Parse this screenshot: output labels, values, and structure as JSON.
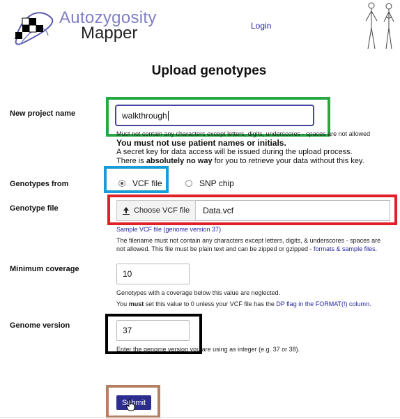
{
  "header": {
    "logo_line1": "Autozygosity",
    "logo_line2": "Mapper",
    "login_label": "Login"
  },
  "page_title": "Upload genotypes",
  "project": {
    "label": "New project name",
    "value": "walkthrough",
    "hint": "Must not contain any characters except letters, digits, underscores - spaces are not allowed",
    "warning_bold": "You must not use patient names or initials.",
    "secret_text_1": "A secret key for data access will be issued during the upload process. There is",
    "secret_text_2_bold": "absolutely no way",
    "secret_text_3": "for you to retrieve your data without this key."
  },
  "genotypes_from": {
    "label": "Genotypes from",
    "options": [
      {
        "label": "VCF file",
        "selected": true
      },
      {
        "label": "SNP chip",
        "selected": false
      }
    ]
  },
  "genotype_file": {
    "label": "Genotype file",
    "button_label": "Choose VCF file",
    "filename": "Data.vcf",
    "sample_link": "Sample VCF file (genome version 37)",
    "note_1": "The filename must not contain any characters except letters, digits, & underscores - spaces are not",
    "note_2": "allowed. This file must be plain text and can be zipped or gzipped -",
    "note_link": "formats & sample files."
  },
  "min_coverage": {
    "label": "Minimum coverage",
    "value": "10",
    "note_1": "Genotypes with a coverage below this value are neglected.",
    "note_2_pre": "You",
    "note_2_bold": "must",
    "note_2_mid": "set this value to 0 unless your VCF file has the",
    "note_2_link": "DP flag in the FORMAT(!) column",
    "note_2_end": "."
  },
  "genome_version": {
    "label": "Genome version",
    "value": "37",
    "note": "Enter the genome version you are using as integer (e.g. 37 or 38)."
  },
  "submit_label": "Submit",
  "colors": {
    "highlight_green": "#27a843",
    "highlight_blue": "#1a9cd8",
    "highlight_red": "#df2027",
    "highlight_black": "#000000",
    "highlight_brown": "#b48062",
    "button_blue": "#2d2d8f",
    "link_blue": "#1f1f9f"
  }
}
